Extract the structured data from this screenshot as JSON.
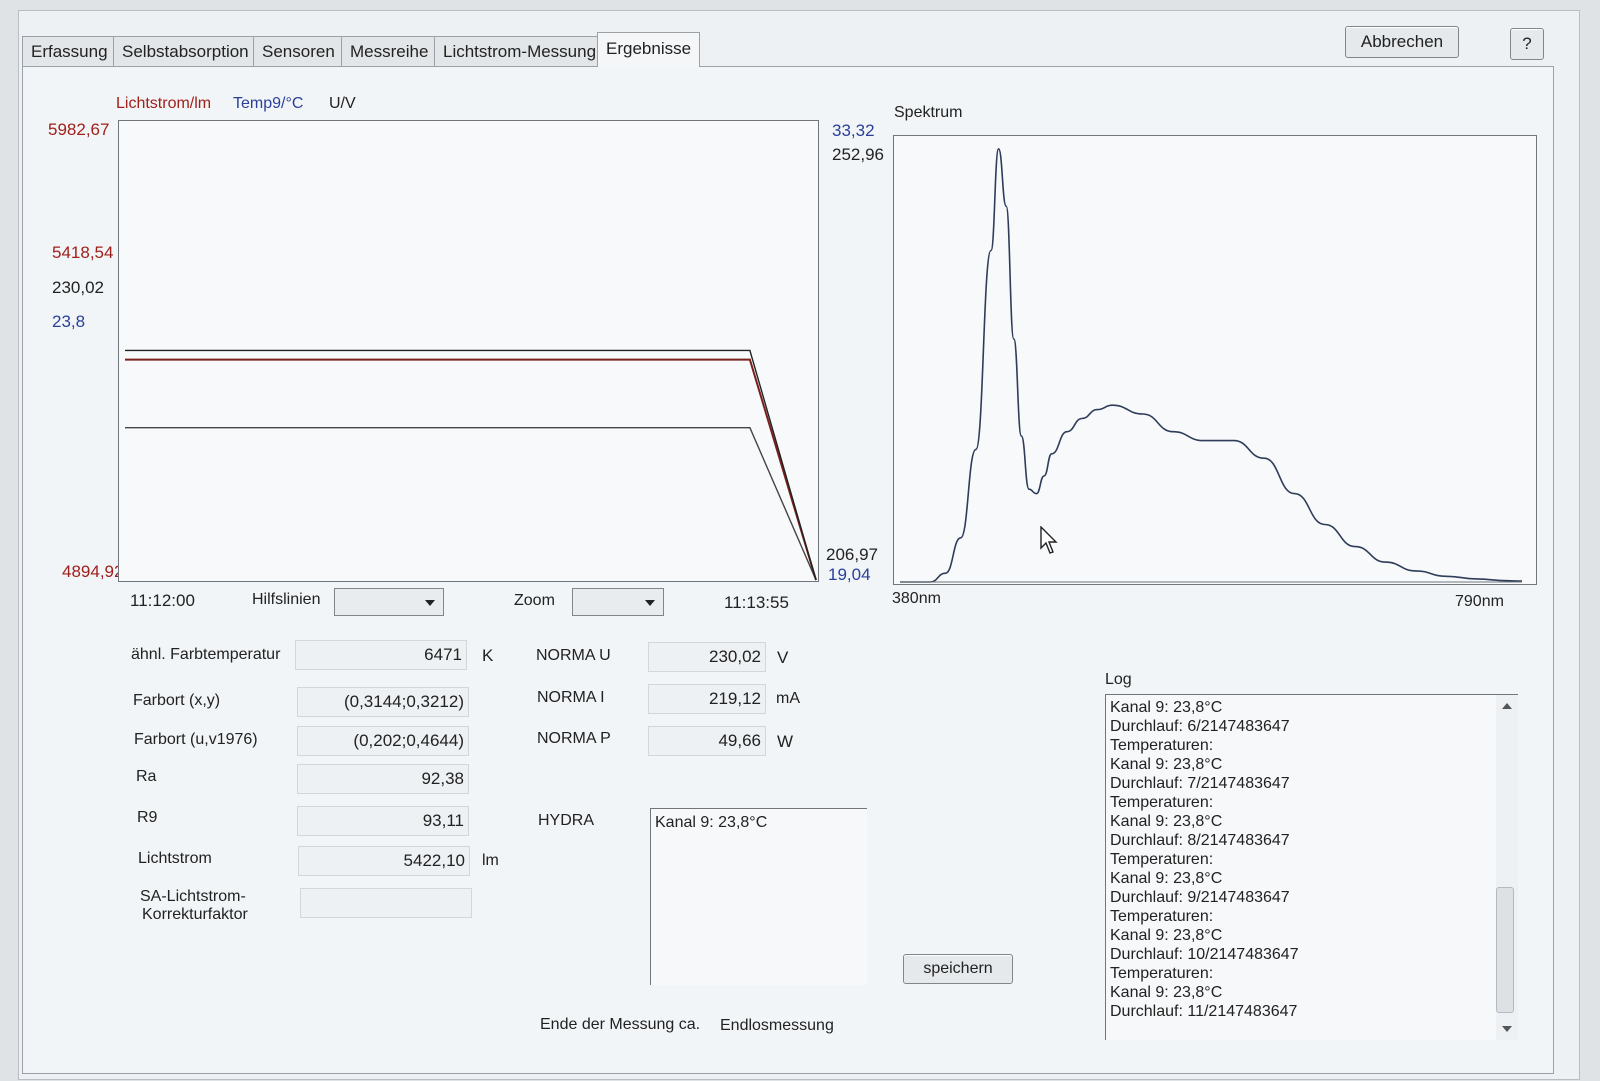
{
  "tabs": [
    {
      "label": "Erfassung"
    },
    {
      "label": "Selbstabsorption"
    },
    {
      "label": "Sensoren"
    },
    {
      "label": "Messreihe"
    },
    {
      "label": "Lichtstrom-Messung"
    },
    {
      "label": "Ergebnisse",
      "active": true
    }
  ],
  "header": {
    "cancel_label": "Abbrechen",
    "help_label": "?"
  },
  "trend": {
    "legend": {
      "lumen": "Lichtstrom/lm",
      "temp": "Temp9/°C",
      "volt": "U/V"
    },
    "left_labels": {
      "max": "5982,67",
      "mid_lumen": "5418,54",
      "mid_volt": "230,02",
      "mid_temp": "23,8",
      "min": "4894,92"
    },
    "right_labels": {
      "max_temp": "33,32",
      "max_volt": "252,96",
      "min_volt": "206,97",
      "min_temp": "19,04"
    },
    "time_start": "11:12:00",
    "time_end": "11:13:55",
    "helplines_label": "Hilfslinien",
    "zoom_label": "Zoom",
    "colors": {
      "lumen": "#7a1f1c",
      "temp": "#444444",
      "volt": "#222222"
    }
  },
  "spectrum": {
    "title": "Spektrum",
    "x_min_label": "380nm",
    "x_max_label": "790nm"
  },
  "chart_data": [
    {
      "type": "line",
      "x": [
        "11:12:00",
        "11:13:44",
        "11:13:55"
      ],
      "xlim": [
        "11:12:00",
        "11:13:55"
      ],
      "series": [
        {
          "name": "Lichtstrom/lm",
          "values": [
            5418.54,
            5418.54,
            4894.92
          ],
          "ylim": [
            4894.92,
            5982.67
          ]
        },
        {
          "name": "Temp9/°C",
          "values": [
            23.8,
            23.8,
            19.04
          ],
          "ylim": [
            19.04,
            33.32
          ]
        },
        {
          "name": "U/V",
          "values": [
            230.02,
            230.02,
            206.97
          ],
          "ylim": [
            206.97,
            252.96
          ]
        }
      ]
    },
    {
      "type": "line",
      "title": "Spektrum",
      "xlim": [
        380,
        790
      ],
      "x": [
        380,
        400,
        410,
        420,
        430,
        440,
        445,
        450,
        455,
        460,
        465,
        470,
        475,
        480,
        490,
        500,
        510,
        520,
        540,
        560,
        580,
        600,
        620,
        640,
        660,
        680,
        700,
        720,
        740,
        760,
        780,
        790
      ],
      "values": [
        0.0,
        0.0,
        0.02,
        0.1,
        0.3,
        0.75,
        0.98,
        0.85,
        0.55,
        0.33,
        0.21,
        0.2,
        0.24,
        0.29,
        0.34,
        0.37,
        0.39,
        0.4,
        0.38,
        0.34,
        0.32,
        0.32,
        0.28,
        0.2,
        0.13,
        0.08,
        0.045,
        0.025,
        0.013,
        0.007,
        0.003,
        0.002
      ],
      "ylim": [
        0,
        1
      ]
    }
  ],
  "results": {
    "cct_label": "ähnl. Farbtemperatur",
    "cct_value": "6471",
    "cct_unit": "K",
    "xy_label": "Farbort (x,y)",
    "xy_value": "(0,3144;0,3212)",
    "uv_label": "Farbort (u,v1976)",
    "uv_value": "(0,202;0,4644)",
    "ra_label": "Ra",
    "ra_value": "92,38",
    "r9_label": "R9",
    "r9_value": "93,11",
    "flux_label": "Lichtstrom",
    "flux_value": "5422,10",
    "flux_unit": "lm",
    "sa_label_1": "SA-Lichtstrom-",
    "sa_label_2": "Korrekturfaktor",
    "sa_value": ""
  },
  "norma": {
    "u_label": "NORMA U",
    "u_value": "230,02",
    "u_unit": "V",
    "i_label": "NORMA I",
    "i_value": "219,12",
    "i_unit": "mA",
    "p_label": "NORMA P",
    "p_value": "49,66",
    "p_unit": "W"
  },
  "hydra": {
    "label": "HYDRA",
    "text": "Kanal 9: 23,8°C"
  },
  "save_label": "speichern",
  "end_label": "Ende der Messung ca.",
  "end_value": "Endlosmessung",
  "log": {
    "title": "Log",
    "lines": [
      "Kanal 9: 23,8°C",
      "Durchlauf: 6/2147483647",
      "Temperaturen:",
      "Kanal 9: 23,8°C",
      "Durchlauf: 7/2147483647",
      "Temperaturen:",
      "Kanal 9: 23,8°C",
      "Durchlauf: 8/2147483647",
      "Temperaturen:",
      "Kanal 9: 23,8°C",
      "Durchlauf: 9/2147483647",
      "Temperaturen:",
      "Kanal 9: 23,8°C",
      "Durchlauf: 10/2147483647",
      "Temperaturen:",
      "Kanal 9: 23,8°C",
      "Durchlauf: 11/2147483647"
    ]
  }
}
